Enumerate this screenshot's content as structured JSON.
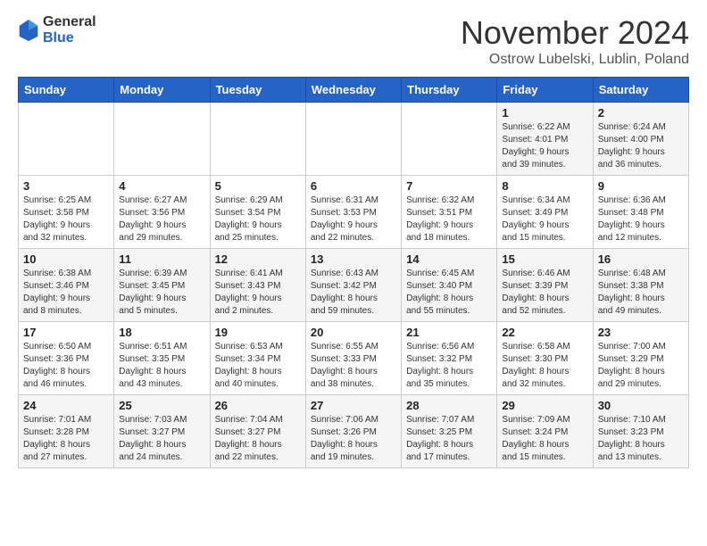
{
  "header": {
    "logo_general": "General",
    "logo_blue": "Blue",
    "month_title": "November 2024",
    "subtitle": "Ostrow Lubelski, Lublin, Poland"
  },
  "days_of_week": [
    "Sunday",
    "Monday",
    "Tuesday",
    "Wednesday",
    "Thursday",
    "Friday",
    "Saturday"
  ],
  "weeks": [
    [
      {
        "day": "",
        "detail": ""
      },
      {
        "day": "",
        "detail": ""
      },
      {
        "day": "",
        "detail": ""
      },
      {
        "day": "",
        "detail": ""
      },
      {
        "day": "",
        "detail": ""
      },
      {
        "day": "1",
        "detail": "Sunrise: 6:22 AM\nSunset: 4:01 PM\nDaylight: 9 hours\nand 39 minutes."
      },
      {
        "day": "2",
        "detail": "Sunrise: 6:24 AM\nSunset: 4:00 PM\nDaylight: 9 hours\nand 36 minutes."
      }
    ],
    [
      {
        "day": "3",
        "detail": "Sunrise: 6:25 AM\nSunset: 3:58 PM\nDaylight: 9 hours\nand 32 minutes."
      },
      {
        "day": "4",
        "detail": "Sunrise: 6:27 AM\nSunset: 3:56 PM\nDaylight: 9 hours\nand 29 minutes."
      },
      {
        "day": "5",
        "detail": "Sunrise: 6:29 AM\nSunset: 3:54 PM\nDaylight: 9 hours\nand 25 minutes."
      },
      {
        "day": "6",
        "detail": "Sunrise: 6:31 AM\nSunset: 3:53 PM\nDaylight: 9 hours\nand 22 minutes."
      },
      {
        "day": "7",
        "detail": "Sunrise: 6:32 AM\nSunset: 3:51 PM\nDaylight: 9 hours\nand 18 minutes."
      },
      {
        "day": "8",
        "detail": "Sunrise: 6:34 AM\nSunset: 3:49 PM\nDaylight: 9 hours\nand 15 minutes."
      },
      {
        "day": "9",
        "detail": "Sunrise: 6:36 AM\nSunset: 3:48 PM\nDaylight: 9 hours\nand 12 minutes."
      }
    ],
    [
      {
        "day": "10",
        "detail": "Sunrise: 6:38 AM\nSunset: 3:46 PM\nDaylight: 9 hours\nand 8 minutes."
      },
      {
        "day": "11",
        "detail": "Sunrise: 6:39 AM\nSunset: 3:45 PM\nDaylight: 9 hours\nand 5 minutes."
      },
      {
        "day": "12",
        "detail": "Sunrise: 6:41 AM\nSunset: 3:43 PM\nDaylight: 9 hours\nand 2 minutes."
      },
      {
        "day": "13",
        "detail": "Sunrise: 6:43 AM\nSunset: 3:42 PM\nDaylight: 8 hours\nand 59 minutes."
      },
      {
        "day": "14",
        "detail": "Sunrise: 6:45 AM\nSunset: 3:40 PM\nDaylight: 8 hours\nand 55 minutes."
      },
      {
        "day": "15",
        "detail": "Sunrise: 6:46 AM\nSunset: 3:39 PM\nDaylight: 8 hours\nand 52 minutes."
      },
      {
        "day": "16",
        "detail": "Sunrise: 6:48 AM\nSunset: 3:38 PM\nDaylight: 8 hours\nand 49 minutes."
      }
    ],
    [
      {
        "day": "17",
        "detail": "Sunrise: 6:50 AM\nSunset: 3:36 PM\nDaylight: 8 hours\nand 46 minutes."
      },
      {
        "day": "18",
        "detail": "Sunrise: 6:51 AM\nSunset: 3:35 PM\nDaylight: 8 hours\nand 43 minutes."
      },
      {
        "day": "19",
        "detail": "Sunrise: 6:53 AM\nSunset: 3:34 PM\nDaylight: 8 hours\nand 40 minutes."
      },
      {
        "day": "20",
        "detail": "Sunrise: 6:55 AM\nSunset: 3:33 PM\nDaylight: 8 hours\nand 38 minutes."
      },
      {
        "day": "21",
        "detail": "Sunrise: 6:56 AM\nSunset: 3:32 PM\nDaylight: 8 hours\nand 35 minutes."
      },
      {
        "day": "22",
        "detail": "Sunrise: 6:58 AM\nSunset: 3:30 PM\nDaylight: 8 hours\nand 32 minutes."
      },
      {
        "day": "23",
        "detail": "Sunrise: 7:00 AM\nSunset: 3:29 PM\nDaylight: 8 hours\nand 29 minutes."
      }
    ],
    [
      {
        "day": "24",
        "detail": "Sunrise: 7:01 AM\nSunset: 3:28 PM\nDaylight: 8 hours\nand 27 minutes."
      },
      {
        "day": "25",
        "detail": "Sunrise: 7:03 AM\nSunset: 3:27 PM\nDaylight: 8 hours\nand 24 minutes."
      },
      {
        "day": "26",
        "detail": "Sunrise: 7:04 AM\nSunset: 3:27 PM\nDaylight: 8 hours\nand 22 minutes."
      },
      {
        "day": "27",
        "detail": "Sunrise: 7:06 AM\nSunset: 3:26 PM\nDaylight: 8 hours\nand 19 minutes."
      },
      {
        "day": "28",
        "detail": "Sunrise: 7:07 AM\nSunset: 3:25 PM\nDaylight: 8 hours\nand 17 minutes."
      },
      {
        "day": "29",
        "detail": "Sunrise: 7:09 AM\nSunset: 3:24 PM\nDaylight: 8 hours\nand 15 minutes."
      },
      {
        "day": "30",
        "detail": "Sunrise: 7:10 AM\nSunset: 3:23 PM\nDaylight: 8 hours\nand 13 minutes."
      }
    ]
  ]
}
